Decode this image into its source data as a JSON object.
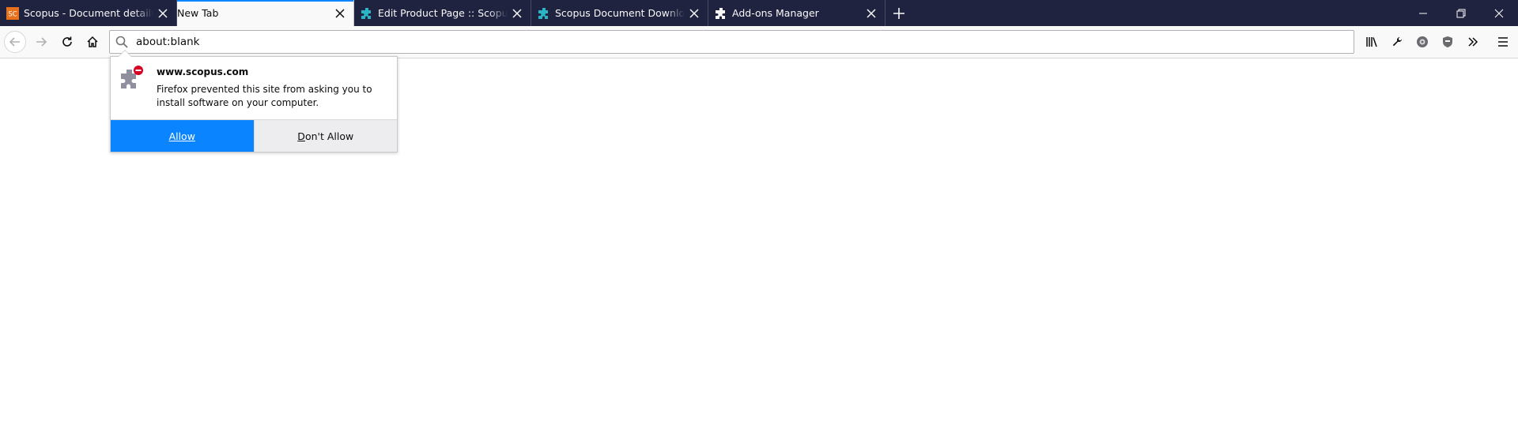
{
  "tabs": [
    {
      "label": "Scopus - Document details | Sig",
      "icon": "scopus-sc-icon",
      "selected": false
    },
    {
      "label": "New Tab",
      "icon": "none",
      "selected": true
    },
    {
      "label": "Edit Product Page :: Scopus Do",
      "icon": "teal-puzzle-icon",
      "selected": false
    },
    {
      "label": "Scopus Document Download M",
      "icon": "teal-puzzle-icon",
      "selected": false
    },
    {
      "label": "Add-ons Manager",
      "icon": "puzzle-icon",
      "selected": false
    }
  ],
  "tab_favicon_text": "SC",
  "urlbar": {
    "value": "about:blank"
  },
  "popup": {
    "site": "www.scopus.com",
    "message": "Firefox prevented this site from asking you to install software on your computer.",
    "allow_label": "Allow",
    "deny_first": "D",
    "deny_rest": "on't Allow"
  },
  "colors": {
    "tabstrip": "#202340",
    "accent": "#0a84ff",
    "teal": "#2bb4c6",
    "scopus_orange": "#e9711c"
  }
}
